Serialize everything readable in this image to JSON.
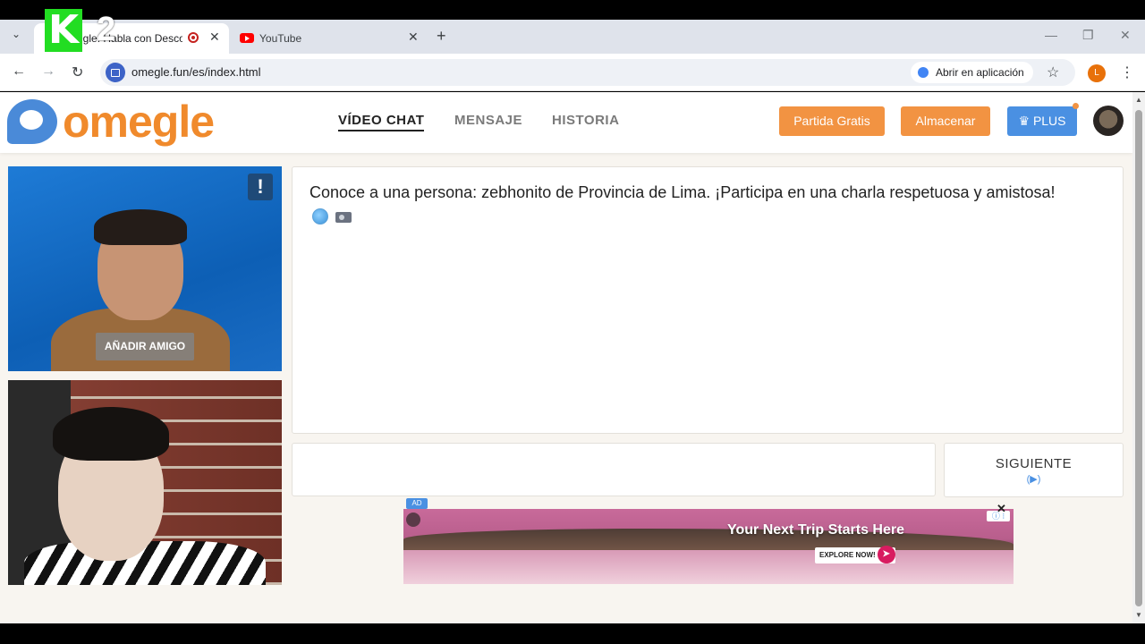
{
  "browser": {
    "tabs": [
      {
        "title": "egle: Habla con Descon",
        "active": true
      },
      {
        "title": "YouTube",
        "active": false
      }
    ],
    "new_tab_label": "+",
    "url": "omegle.fun/es/index.html",
    "open_in_app": "Abrir en aplicación",
    "profile_initial": "L",
    "overlay_logo": {
      "letter": "K",
      "number": "2"
    }
  },
  "site": {
    "brand": "omegle",
    "nav": {
      "video_chat": "VÍDEO CHAT",
      "messages": "MENSAJE",
      "history": "HISTORIA"
    },
    "buttons": {
      "free_match": "Partida Gratis",
      "store": "Almacenar",
      "plus": "PLUS"
    }
  },
  "video": {
    "report_label": "!",
    "add_friend": "AÑADIR AMIGO"
  },
  "chat": {
    "message": "Conoce a una persona: zebhonito de Provincia de Lima. ¡Participa en una charla respetuosa y amistosa!",
    "input_value": "",
    "next_label": "SIGUIENTE",
    "next_hint": "(▶)"
  },
  "ad": {
    "tag": "AD",
    "title": "Your Next Trip Starts Here",
    "cta": "EXPLORE NOW!",
    "close": "✕"
  },
  "colors": {
    "brand_orange": "#f08a2c",
    "accent_blue": "#4a90e2",
    "button_orange": "#f29342"
  }
}
